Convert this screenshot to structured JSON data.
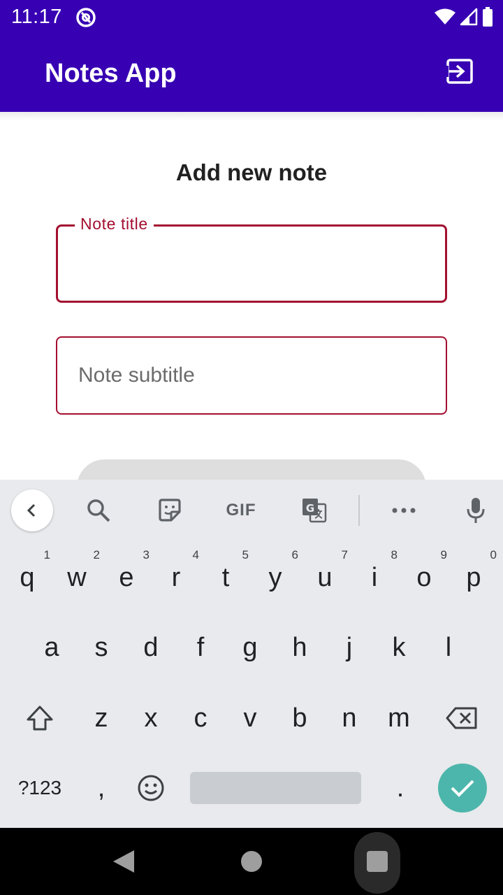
{
  "status_bar": {
    "time": "11:17"
  },
  "app_bar": {
    "title": "Notes App",
    "exit_icon": "exit-to-app-icon",
    "background_color": "#3700b3"
  },
  "form": {
    "heading": "Add new note",
    "title_field": {
      "label": "Note title",
      "value": ""
    },
    "subtitle_field": {
      "placeholder": "Note subtitle",
      "value": ""
    },
    "accent_color": "#a31030"
  },
  "keyboard": {
    "toolbar_icons": [
      "chevron-left-icon",
      "search-icon",
      "sticker-icon",
      "gif-icon",
      "translate-icon",
      "more-icon",
      "mic-icon"
    ],
    "gif_label": "GIF",
    "more_label": "•••",
    "row1": [
      {
        "key": "q",
        "hint": "1"
      },
      {
        "key": "w",
        "hint": "2"
      },
      {
        "key": "e",
        "hint": "3"
      },
      {
        "key": "r",
        "hint": "4"
      },
      {
        "key": "t",
        "hint": "5"
      },
      {
        "key": "y",
        "hint": "6"
      },
      {
        "key": "u",
        "hint": "7"
      },
      {
        "key": "i",
        "hint": "8"
      },
      {
        "key": "o",
        "hint": "9"
      },
      {
        "key": "p",
        "hint": "0"
      }
    ],
    "row2": [
      "a",
      "s",
      "d",
      "f",
      "g",
      "h",
      "j",
      "k",
      "l"
    ],
    "row3": [
      "z",
      "x",
      "c",
      "v",
      "b",
      "n",
      "m"
    ],
    "row4": {
      "symbols_label": "?123",
      "comma": ",",
      "period": "."
    },
    "enter_color": "#4db6ac"
  }
}
